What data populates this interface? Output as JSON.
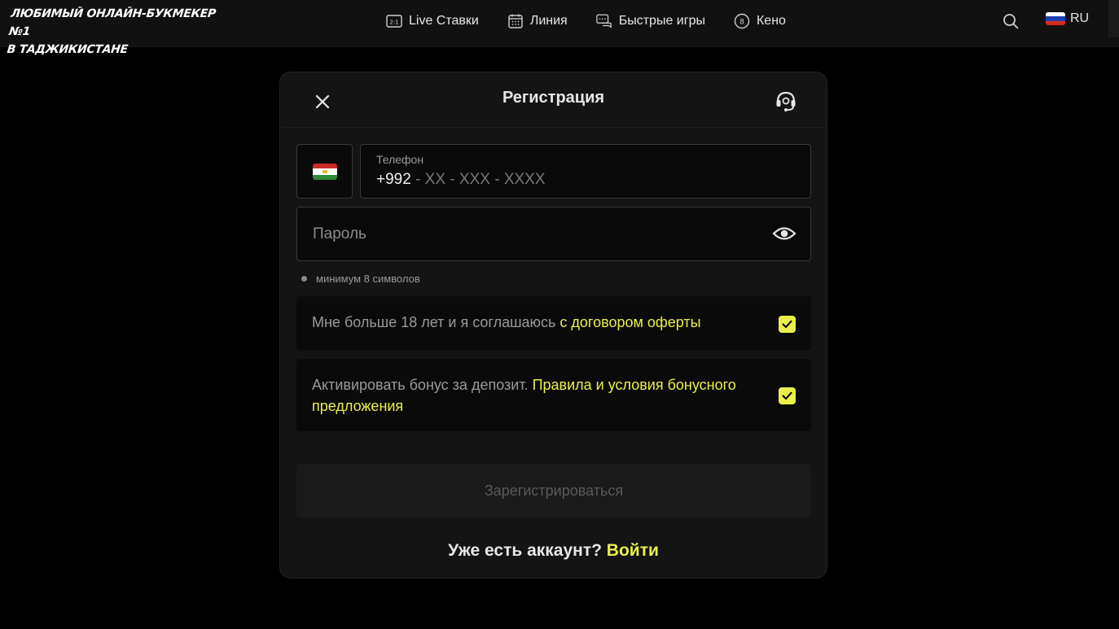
{
  "header": {
    "brand_line1": "ЛЮБИМЫЙ ОНЛАЙН-БУКМЕКЕР №1",
    "brand_line2": "В ТАДЖИКИСТАНЕ",
    "nav": [
      {
        "label": "Live Ставки",
        "icon": "live-icon"
      },
      {
        "label": "Линия",
        "icon": "calendar-icon"
      },
      {
        "label": "Быстрые игры",
        "icon": "chat-games-icon"
      },
      {
        "label": "Кено",
        "icon": "keno-ball-icon"
      }
    ],
    "live_icon_text": "2:1",
    "keno_icon_text": "8",
    "language": "RU"
  },
  "modal": {
    "title": "Регистрация",
    "phone": {
      "label": "Телефон",
      "prefix": "+992",
      "mask": " - XX - XXX - XXXX"
    },
    "password_placeholder": "Пароль",
    "hint": "минимум 8 символов",
    "agree_text": "Мне больше 18 лет и я соглашаюсь ",
    "agree_link": "с договором оферты",
    "bonus_text": "Активировать бонус за депозит. ",
    "bonus_link": "Правила и условия бонусного предложения",
    "submit_label": "Зарегистрироваться",
    "login_prompt": "Уже есть аккаунт? ",
    "login_link": "Войти"
  },
  "colors": {
    "accent": "#e9f04a",
    "background": "#000000",
    "panel": "#141414"
  }
}
